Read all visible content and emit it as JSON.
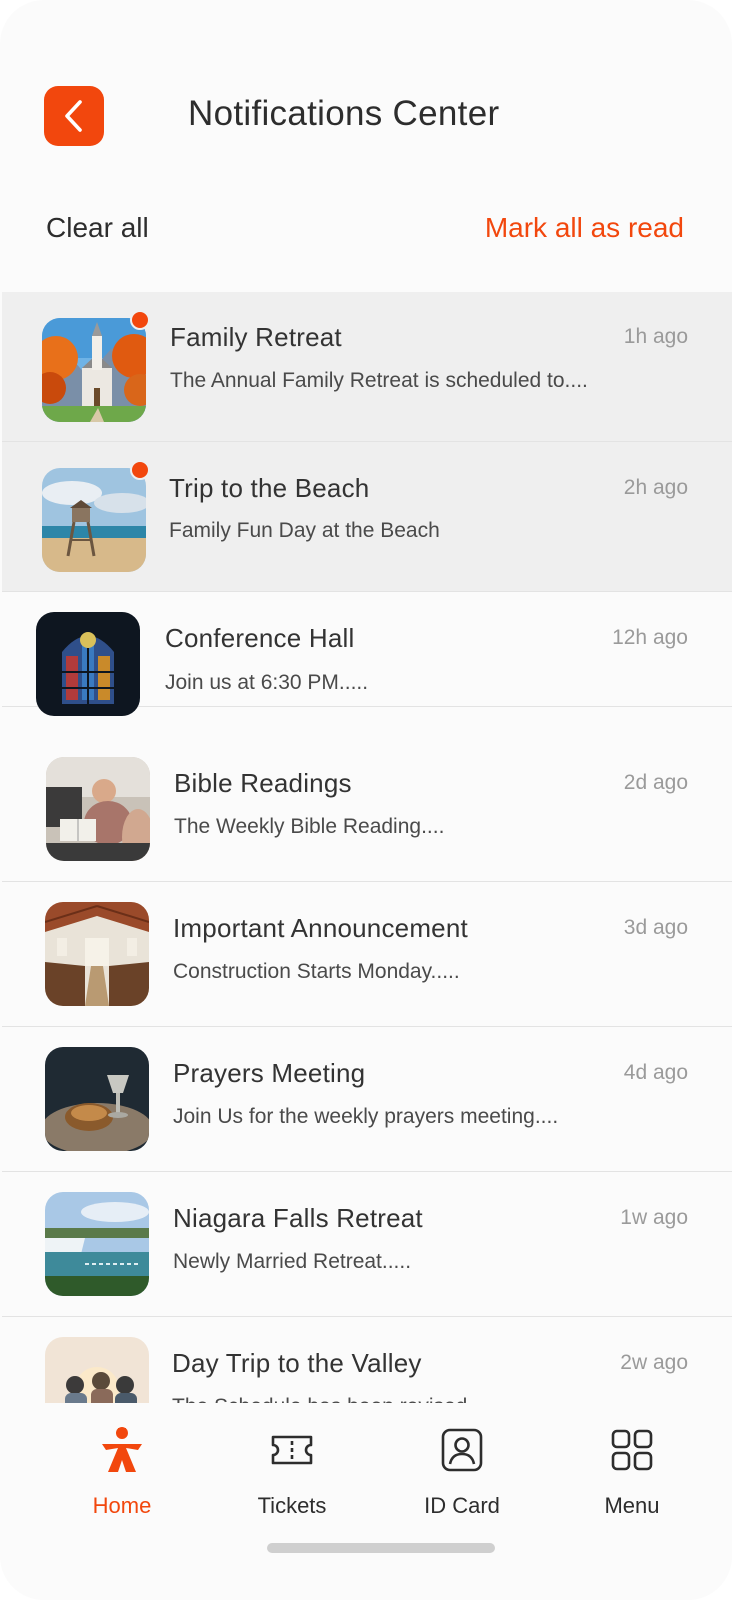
{
  "header": {
    "title": "Notifications Center",
    "back_icon": "chevron-left-icon"
  },
  "actions": {
    "clear_all": "Clear all",
    "mark_all_read": "Mark all as read"
  },
  "notifications": [
    {
      "title": "Family Retreat",
      "message": "The Annual Family Retreat is scheduled to....",
      "time": "1h ago",
      "unread": true,
      "image": "church-autumn-image"
    },
    {
      "title": "Trip to the Beach",
      "message": "Family Fun Day at the Beach",
      "time": "2h ago",
      "unread": true,
      "image": "beach-lifeguard-tower-image"
    },
    {
      "title": "Conference Hall",
      "message": "Join us at 6:30 PM.....",
      "time": "12h ago",
      "unread": false,
      "image": "stained-glass-window-image"
    },
    {
      "title": "Bible Readings",
      "message": "The Weekly Bible Reading....",
      "time": "2d ago",
      "unread": false,
      "image": "people-reading-bible-image"
    },
    {
      "title": "Important Announcement",
      "message": "Construction Starts Monday.....",
      "time": "3d ago",
      "unread": false,
      "image": "church-interior-image"
    },
    {
      "title": "Prayers Meeting",
      "message": "Join Us for the weekly prayers meeting....",
      "time": "4d ago",
      "unread": false,
      "image": "bread-and-chalice-image"
    },
    {
      "title": "Niagara Falls Retreat",
      "message": "Newly Married Retreat.....",
      "time": "1w ago",
      "unread": false,
      "image": "niagara-falls-image"
    },
    {
      "title": "Day Trip to the Valley",
      "message": "The Schedule has been revised",
      "time": "2w ago",
      "unread": false,
      "image": "friends-sunset-image"
    }
  ],
  "bottom_nav": [
    {
      "label": "Home",
      "icon": "home-person-icon",
      "active": true
    },
    {
      "label": "Tickets",
      "icon": "ticket-icon",
      "active": false
    },
    {
      "label": "ID Card",
      "icon": "id-card-icon",
      "active": false
    },
    {
      "label": "Menu",
      "icon": "grid-menu-icon",
      "active": false
    }
  ],
  "colors": {
    "accent": "#f2470d",
    "unread_bg": "#efefef",
    "background": "#fbfbfb"
  }
}
